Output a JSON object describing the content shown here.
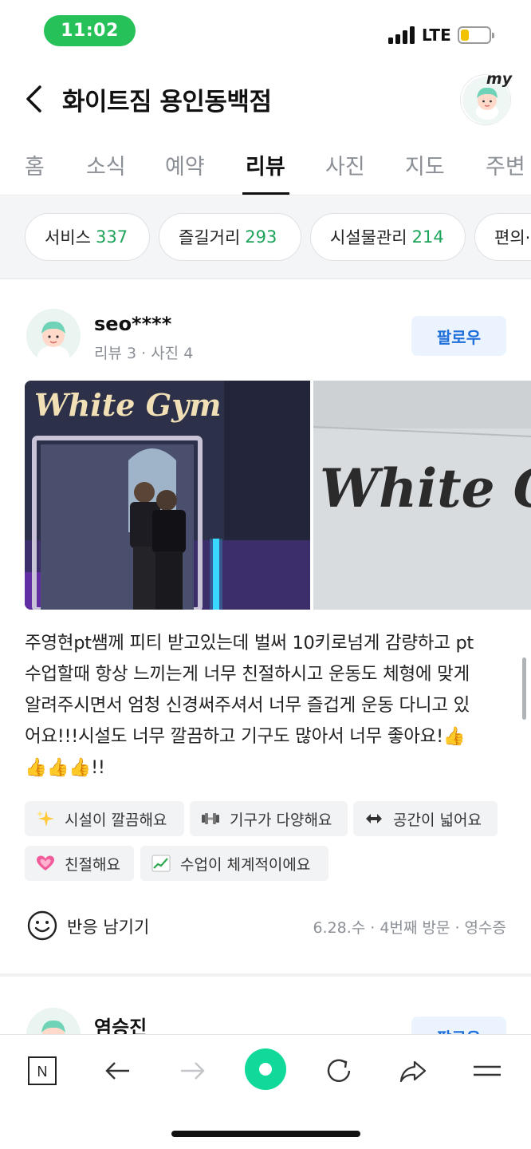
{
  "status_bar": {
    "time": "11:02",
    "network": "LTE",
    "battery_level": 0.3,
    "time_pill_color": "#27c15a"
  },
  "header": {
    "place_name": "화이트짐 용인동백점",
    "my_badge": "my"
  },
  "tabs": [
    {
      "label": "홈"
    },
    {
      "label": "소식"
    },
    {
      "label": "예약"
    },
    {
      "label": "리뷰",
      "active": true
    },
    {
      "label": "사진"
    },
    {
      "label": "지도"
    },
    {
      "label": "주변"
    }
  ],
  "keyword_chips": [
    {
      "label": "서비스",
      "count": "337"
    },
    {
      "label": "즐길거리",
      "count": "293"
    },
    {
      "label": "시설물관리",
      "count": "214"
    },
    {
      "label": "편의·"
    }
  ],
  "review": {
    "user_name": "seo****",
    "user_stats": "리뷰 3 · 사진 4",
    "follow_label": "팔로우",
    "photo1_sign": "White Gym",
    "photo2_sign": "White Gy",
    "text_lines": [
      "주영현pt쌤께 피티 받고있는데 벌써 10키로넘게 감량하고 pt",
      "수업할때 항상 느끼는게 너무 친절하시고 운동도 체형에 맞게",
      "알려주시면서 엄청 신경써주셔서 너무 즐겁게 운동 다니고 있",
      "어요!!!시설도 너무 깔끔하고 기구도 많아서 너무 좋아요!👍",
      "👍👍👍!!"
    ],
    "tags": [
      {
        "icon": "sparkles-icon",
        "label": "시설이 깔끔해요"
      },
      {
        "icon": "dumbbell-icon",
        "label": "기구가 다양해요"
      },
      {
        "icon": "left-right-arrow-icon",
        "label": "공간이 넓어요"
      },
      {
        "icon": "heart-icon",
        "label": "친절해요"
      },
      {
        "icon": "chart-up-icon",
        "label": "수업이 체계적이에요"
      }
    ],
    "react_label": "반응 남기기",
    "visit_meta": "6.28.수 · 4번째 방문 · 영수증"
  },
  "review2": {
    "user_name": "염승진",
    "follow_label": "팔로우"
  },
  "bottom_nav": {
    "accent": "#10d99a",
    "home_letter": "N"
  },
  "colors": {
    "count_green": "#1fa35a",
    "follow_blue": "#1e6fd9",
    "muted": "#8b8f96"
  }
}
